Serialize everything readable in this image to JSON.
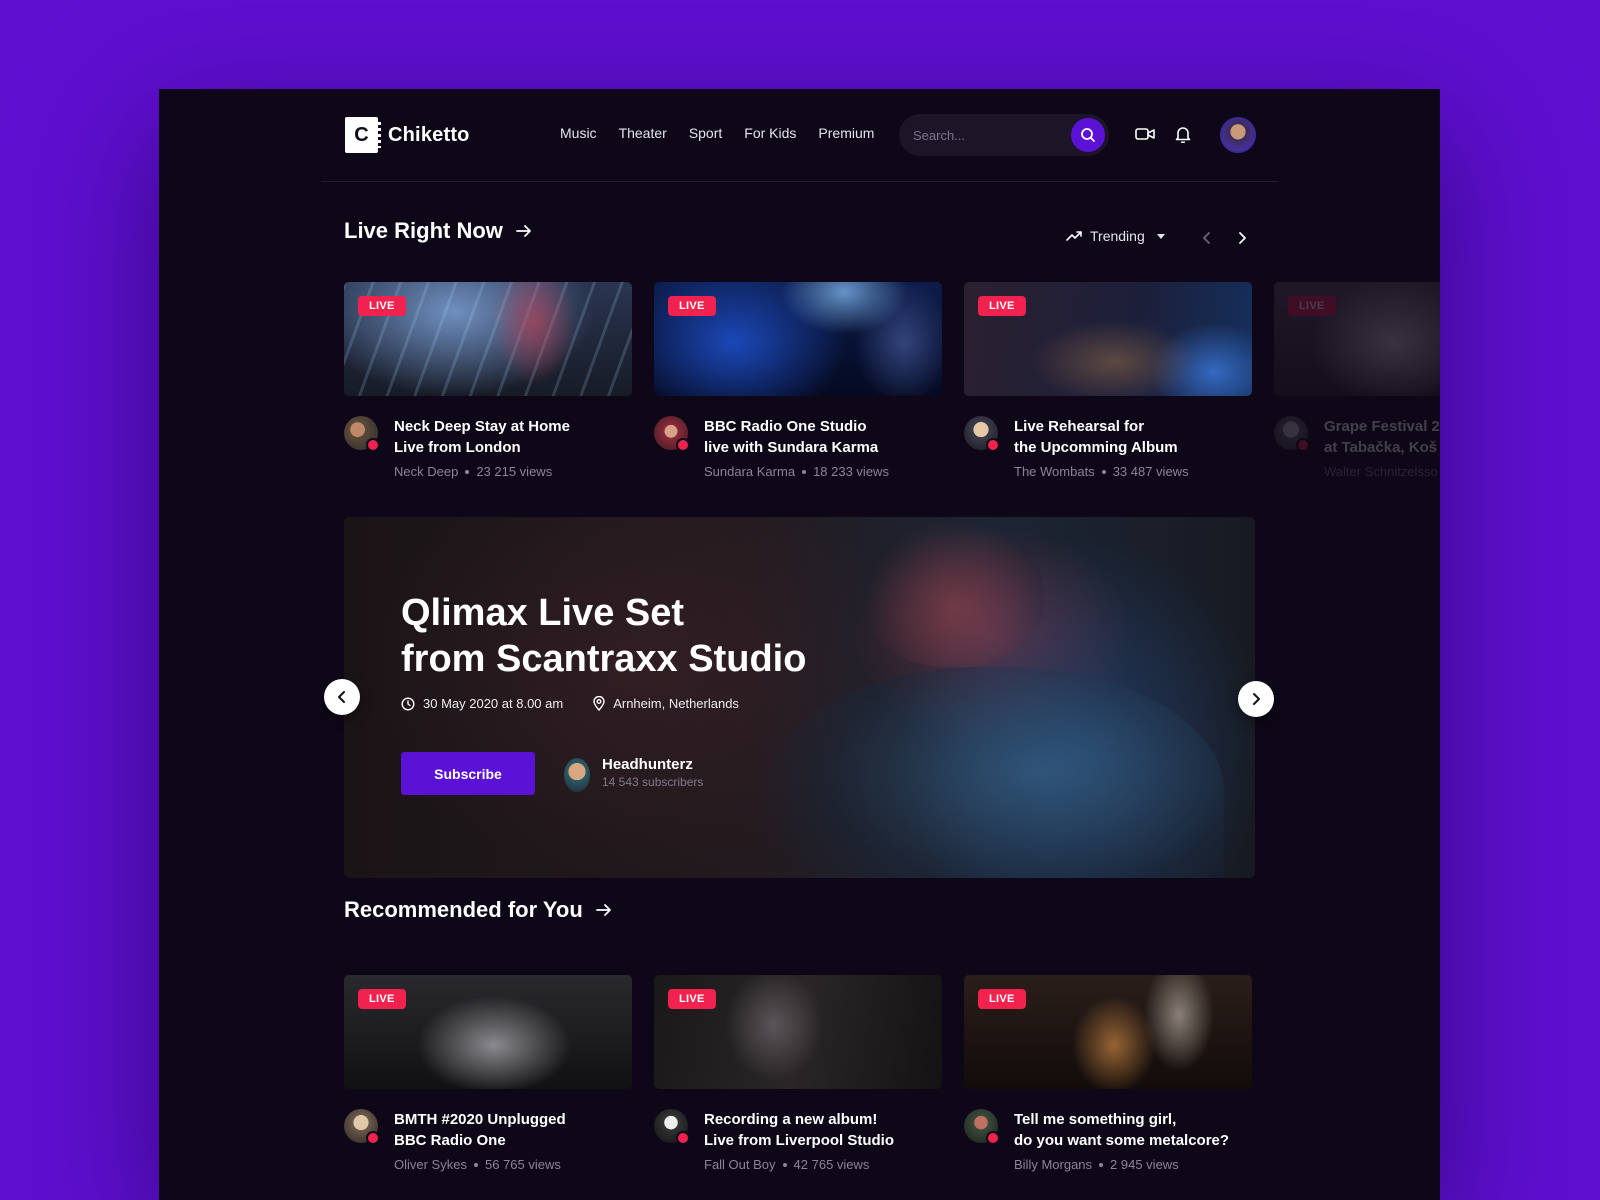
{
  "app": {
    "name": "Chiketto",
    "logo_letter": "C"
  },
  "nav": [
    {
      "label": "Music"
    },
    {
      "label": "Theater"
    },
    {
      "label": "Sport"
    },
    {
      "label": "For Kids"
    },
    {
      "label": "Premium"
    }
  ],
  "search": {
    "placeholder": "Search..."
  },
  "live_section": {
    "title": "Live Right Now",
    "sort_label": "Trending",
    "cards": [
      {
        "badge": "LIVE",
        "title": "Neck Deep Stay at Home\nLive from London",
        "author": "Neck Deep",
        "views": "23 215 views"
      },
      {
        "badge": "LIVE",
        "title": "BBC Radio One Studio\nlive with Sundara Karma",
        "author": "Sundara Karma",
        "views": "18 233 views"
      },
      {
        "badge": "LIVE",
        "title": "Live Rehearsal for\nthe Upcomming Album",
        "author": "The Wombats",
        "views": "33 487 views"
      },
      {
        "badge": "LIVE",
        "title": "Grape Festival 2\nat Tabačka, Koš",
        "author": "Walter Schnitzelsso",
        "views": ""
      }
    ]
  },
  "hero": {
    "title": "Qlimax Live Set\nfrom Scantraxx Studio",
    "date": "30 May 2020 at 8.00 am",
    "location": "Arnheim, Netherlands",
    "subscribe_label": "Subscribe",
    "channel_name": "Headhunterz",
    "channel_subs": "14 543 subscribers"
  },
  "recommended_section": {
    "title": "Recommended for You",
    "cards": [
      {
        "badge": "LIVE",
        "title": "BMTH #2020 Unplugged\nBBC Radio One",
        "author": "Oliver Sykes",
        "views": "56 765 views"
      },
      {
        "badge": "LIVE",
        "title": "Recording a new album!\nLive from Liverpool Studio",
        "author": "Fall Out Boy",
        "views": "42 765 views"
      },
      {
        "badge": "LIVE",
        "title": "Tell me something girl,\ndo you want some metalcore?",
        "author": "Billy Morgans",
        "views": "2 945 views"
      }
    ]
  },
  "colors": {
    "accent": "#5c12d6",
    "live": "#f2224e",
    "background": "#0e0718",
    "page": "#5f0fd0"
  }
}
